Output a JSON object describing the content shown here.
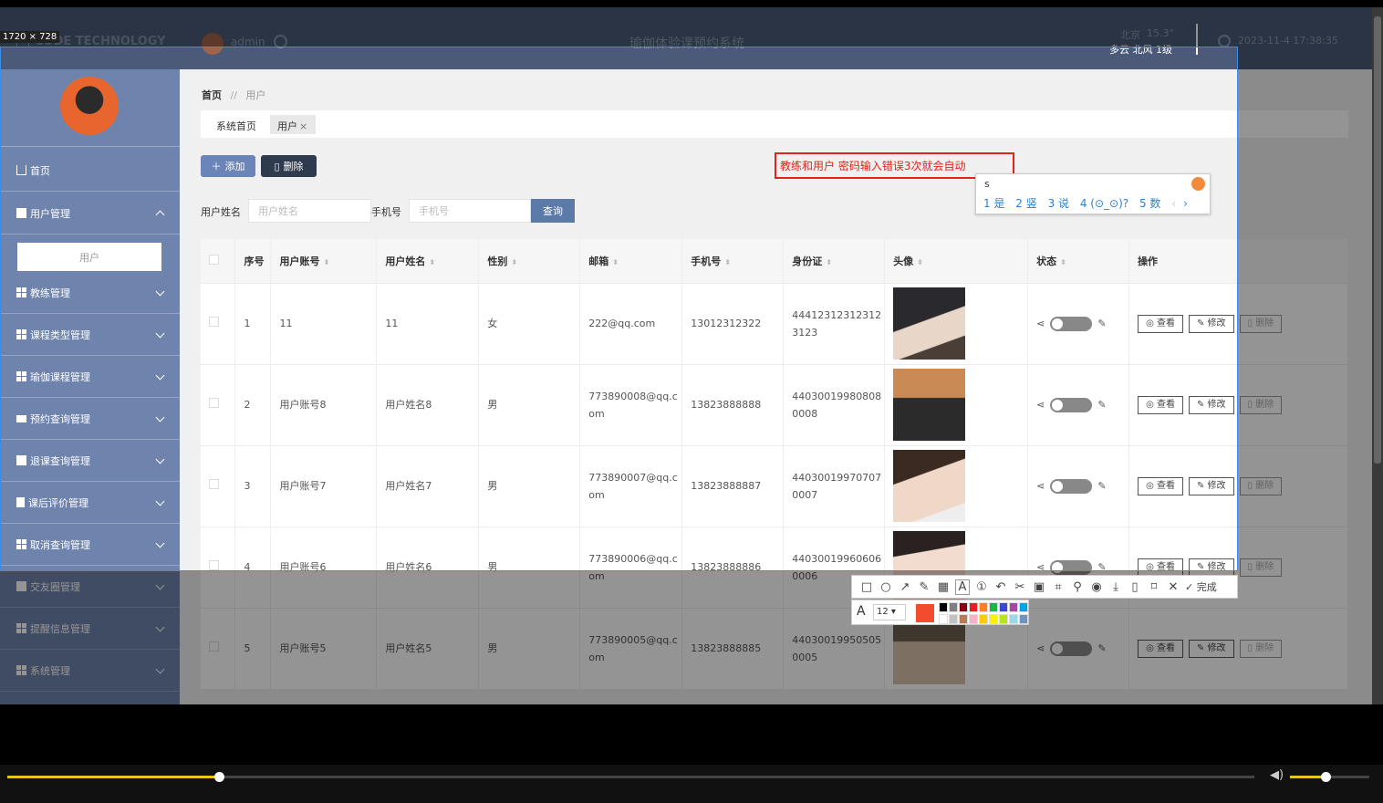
{
  "topbar": {
    "brand": "CODE TECHNOLOGY",
    "user": "admin",
    "system_title": "瑜伽体验课预约系统",
    "weather_city": "北京",
    "weather_temp": "15.3°",
    "weather_desc": "多云 北风 1级",
    "datetime": "2023-11-4 17:38:35"
  },
  "sidebar": {
    "items": [
      {
        "label": "首页"
      },
      {
        "label": "用户管理"
      },
      {
        "label": "用户"
      },
      {
        "label": "教练管理"
      },
      {
        "label": "课程类型管理"
      },
      {
        "label": "瑜伽课程管理"
      },
      {
        "label": "预约查询管理"
      },
      {
        "label": "退课查询管理"
      },
      {
        "label": "课后评价管理"
      },
      {
        "label": "取消查询管理"
      },
      {
        "label": "交友圈管理"
      },
      {
        "label": "提醒信息管理"
      },
      {
        "label": "系统管理"
      }
    ]
  },
  "breadcrumb": {
    "home": "首页",
    "sep": "//",
    "current": "用户"
  },
  "tabs": [
    {
      "label": "系统首页"
    },
    {
      "label": "用户"
    }
  ],
  "toolbar": {
    "add": "添加",
    "delete": "删除"
  },
  "search": {
    "name_label": "用户姓名",
    "name_placeholder": "用户姓名",
    "phone_label": "手机号",
    "phone_placeholder": "手机号",
    "query": "查询"
  },
  "table": {
    "headers": [
      "序号",
      "用户账号",
      "用户姓名",
      "性别",
      "邮箱",
      "手机号",
      "身份证",
      "头像",
      "状态",
      "操作"
    ],
    "rows": [
      {
        "no": "1",
        "account": "11",
        "name": "11",
        "gender": "女",
        "email": "222@qq.com",
        "phone": "13012312322",
        "idcard": "444123123123123123"
      },
      {
        "no": "2",
        "account": "用户账号8",
        "name": "用户姓名8",
        "gender": "男",
        "email": "773890008@qq.com",
        "phone": "13823888888",
        "idcard": "440300199808080008"
      },
      {
        "no": "3",
        "account": "用户账号7",
        "name": "用户姓名7",
        "gender": "男",
        "email": "773890007@qq.com",
        "phone": "13823888887",
        "idcard": "440300199707070007"
      },
      {
        "no": "4",
        "account": "用户账号6",
        "name": "用户姓名6",
        "gender": "男",
        "email": "773890006@qq.com",
        "phone": "13823888886",
        "idcard": "440300199606060006"
      },
      {
        "no": "5",
        "account": "用户账号5",
        "name": "用户姓名5",
        "gender": "男",
        "email": "773890005@qq.com",
        "phone": "13823888885",
        "idcard": "440300199505050005"
      }
    ],
    "actions": {
      "view": "查看",
      "edit": "修改",
      "delete": "删除"
    }
  },
  "overlay": {
    "size_label": "1720 × 728",
    "annotation_text": "教练和用户 密码输入错误3次就会自动",
    "ime_input": "s",
    "ime_candidates": [
      "1 是",
      "2 竖",
      "3 说",
      "4 (⊙_⊙)?",
      "5 数"
    ],
    "font_size": "12",
    "done_label": "完成",
    "palette": [
      "#000000",
      "#7f7f7f",
      "#880015",
      "#ed1c24",
      "#ff7f27",
      "#22b14c",
      "#3f48cc",
      "#a349a4",
      "#00a2e8",
      "#ffffff",
      "#c3c3c3",
      "#b97a57",
      "#ffaec9",
      "#ffc90e",
      "#fff200",
      "#b5e61d",
      "#99d9ea",
      "#7092be"
    ],
    "selected_color": "#f24b2e"
  }
}
